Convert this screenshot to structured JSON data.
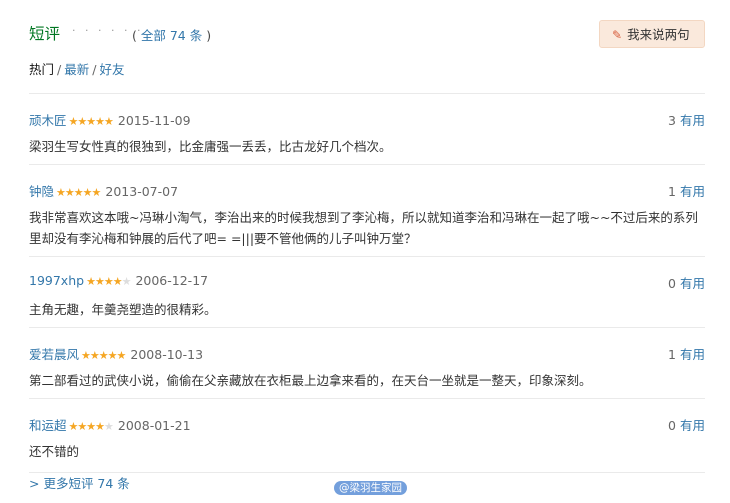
{
  "section": {
    "title": "短评",
    "dots": "· · · · · ·",
    "total_prefix": "( ",
    "total_label": "全部 74 条",
    "total_suffix": " )",
    "write_button": "我来说两句"
  },
  "tabs": {
    "hot": "热门",
    "newest": "最新",
    "friends": "好友"
  },
  "comments": [
    {
      "author": "顽木匠",
      "rating": 5,
      "date": "2015-11-09",
      "votes": "3",
      "vote_label": "有用",
      "text": "梁羽生写女性真的很独到，比金庸强一丢丢，比古龙好几个档次。"
    },
    {
      "author": "钟隐",
      "rating": 5,
      "date": "2013-07-07",
      "votes": "1",
      "vote_label": "有用",
      "text": "我非常喜欢这本哦~冯琳小淘气，李治出来的时候我想到了李沁梅，所以就知道李治和冯琳在一起了哦~~不过后来的系列里却没有李沁梅和钟展的后代了吧= =|||要不管他俩的儿子叫钟万堂？"
    },
    {
      "author": "1997xhp",
      "rating": 4,
      "date": "2006-12-17",
      "votes": "0",
      "vote_label": "有用",
      "text": "主角无趣，年羹尧塑造的很精彩。"
    },
    {
      "author": "爱若晨风",
      "rating": 5,
      "date": "2008-10-13",
      "votes": "1",
      "vote_label": "有用",
      "text": "第二部看过的武侠小说，偷偷在父亲藏放在衣柜最上边拿来看的，在天台一坐就是一整天，印象深刻。"
    },
    {
      "author": "和运超",
      "rating": 4,
      "date": "2008-01-21",
      "votes": "0",
      "vote_label": "有用",
      "text": "还不错的"
    }
  ],
  "more_link": "> 更多短评 74 条",
  "watermark": "@梁羽生家园",
  "colors": {
    "link": "#3377aa",
    "title": "#007722",
    "star": "#f5a623",
    "button_bg": "#fae9dc"
  }
}
